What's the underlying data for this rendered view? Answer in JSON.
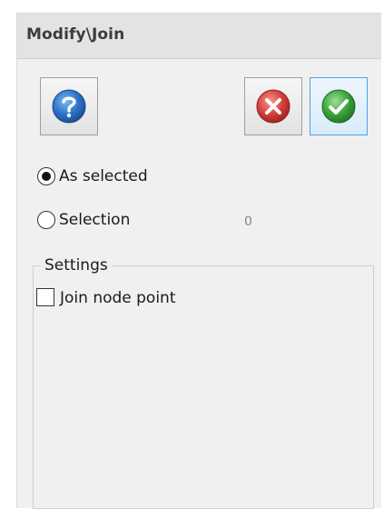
{
  "panel": {
    "title": "Modify\\Join"
  },
  "toolbar": {
    "help_icon": "question-icon",
    "cancel_icon": "red-x-icon",
    "ok_icon": "green-check-icon"
  },
  "options": {
    "as_selected_label": "As selected",
    "as_selected_checked": true,
    "selection_label": "Selection",
    "selection_checked": false,
    "selection_count": "0"
  },
  "settings": {
    "legend": "Settings",
    "join_node_point_label": "Join node point",
    "join_node_point_checked": false
  },
  "colors": {
    "help_blue": "#2f74c8",
    "cancel_red": "#d8403c",
    "ok_green": "#3aa63a",
    "ok_border": "#4da3e6",
    "panel_bg": "#f0f0f0",
    "title_bg": "#e3e3e3"
  }
}
